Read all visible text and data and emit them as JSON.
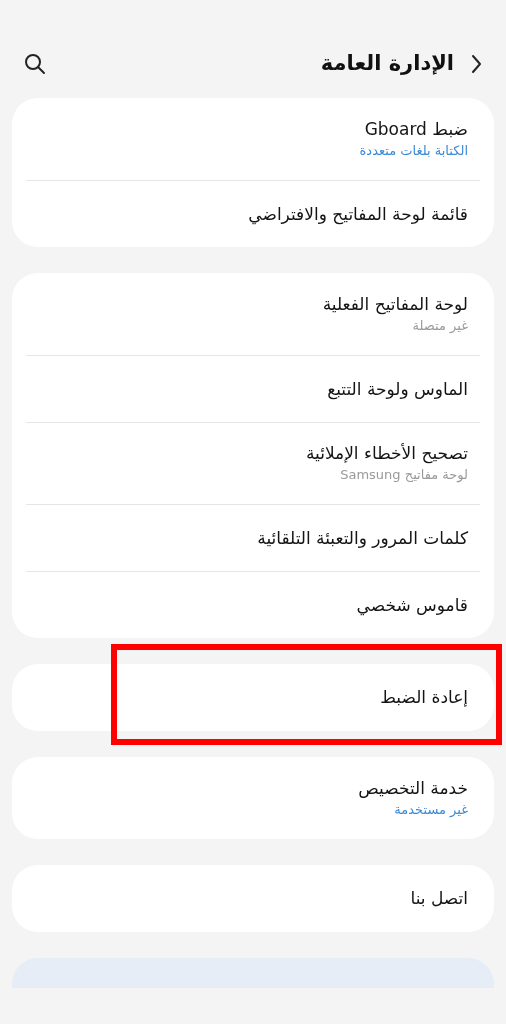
{
  "header": {
    "title": "الإدارة العامة"
  },
  "groups": [
    {
      "items": [
        {
          "title": "ضبط Gboard",
          "subtitle": {
            "text": "الكتابة بلغات متعددة",
            "color": "#3a8ad6"
          },
          "highlighted": false
        },
        {
          "title": "قائمة لوحة المفاتيح والافتراضي",
          "highlighted": false
        }
      ]
    },
    {
      "items": [
        {
          "title": "لوحة المفاتيح الفعلية",
          "subtitle": {
            "text": "غير متصلة",
            "color": "#9a9a9a"
          },
          "highlighted": false
        },
        {
          "title": "الماوس ولوحة التتبع",
          "highlighted": false
        },
        {
          "title": "تصحيح الأخطاء الإملائية",
          "subtitle": {
            "text": "لوحة مفاتيح Samsung",
            "color": "#9a9a9a"
          },
          "highlighted": false
        },
        {
          "title": "كلمات المرور والتعبئة التلقائية",
          "highlighted": false
        },
        {
          "title": "قاموس شخصي",
          "highlighted": false
        }
      ]
    },
    {
      "items": [
        {
          "title": "إعادة الضبط",
          "highlighted": true
        }
      ]
    },
    {
      "items": [
        {
          "title": "خدمة التخصيص",
          "subtitle": {
            "text": "غير مستخدمة",
            "color": "#3a8ad6"
          },
          "highlighted": false
        }
      ]
    },
    {
      "items": [
        {
          "title": "اتصل بنا",
          "highlighted": false
        }
      ]
    }
  ]
}
